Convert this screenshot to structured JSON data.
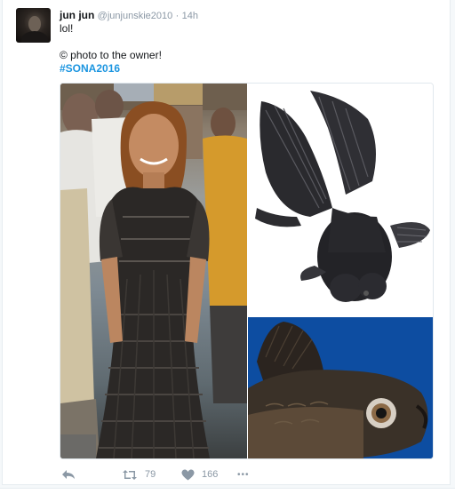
{
  "tweet": {
    "author": {
      "fullname": "jun jun",
      "handle": "@junjunskie2010",
      "separator": "·",
      "time": "14h"
    },
    "text_line_1": "lol!",
    "text_line_2": "© photo to the owner!",
    "hashtag": "#SONA2016"
  },
  "actions": {
    "reply": {
      "icon": "reply-icon"
    },
    "retweet": {
      "icon": "retweet-icon",
      "count": "79"
    },
    "like": {
      "icon": "heart-icon",
      "count": "166"
    },
    "more": {
      "icon": "more-icon",
      "label": "•••"
    }
  },
  "colors": {
    "link": "#1b95e0",
    "muted": "#8b98a5",
    "fish_background": "#0d4da1"
  }
}
